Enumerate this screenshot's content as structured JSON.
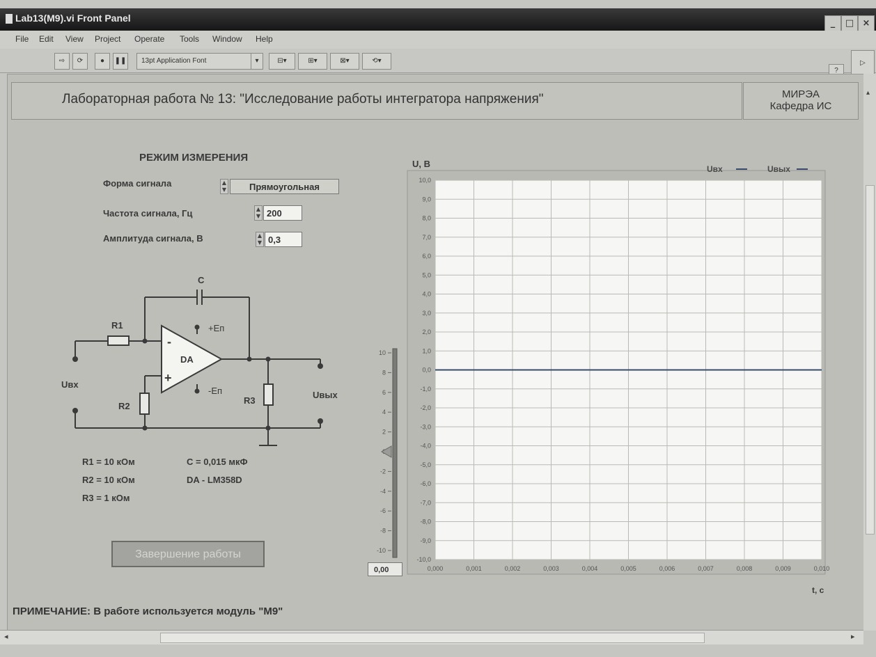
{
  "window": {
    "title": "Lab13(M9).vi Front Panel"
  },
  "menu": [
    "File",
    "Edit",
    "View",
    "Project",
    "Operate",
    "Tools",
    "Window",
    "Help"
  ],
  "toolbar": {
    "font_selector": "13pt Application Font",
    "help_icon": "?"
  },
  "header": {
    "title": "Лабораторная работа № 13: \"Исследование работы интегратора напряжения\"",
    "org_line1": "МИРЭА",
    "org_line2": "Кафедра ИС"
  },
  "controls": {
    "section_title": "РЕЖИМ ИЗМЕРЕНИЯ",
    "waveform_label": "Форма сигнала",
    "waveform_value": "Прямоугольная",
    "frequency_label": "Частота сигнала, Гц",
    "frequency_value": "200",
    "amplitude_label": "Амплитуда сигнала, В",
    "amplitude_value": "0,3"
  },
  "circuit": {
    "c_label": "C",
    "r1_label": "R1",
    "r2_label": "R2",
    "r3_label": "R3",
    "da_label": "DA",
    "minus": "-",
    "plus": "+",
    "vplus": "+Eп",
    "vminus": "-Eп",
    "uin": "Uвх",
    "uout": "Uвых"
  },
  "params": {
    "r1": "R1 = 10 кОм",
    "r2": "R2 = 10 кОм",
    "r3": "R3 = 1 кОм",
    "c": "C  =  0,015 мкФ",
    "da": "DA - LM358D"
  },
  "exit_button": "Завершение работы",
  "note": "ПРИМЕЧАНИЕ: В работе используется модуль \"М9\"",
  "slider": {
    "ticks": [
      "10",
      "8",
      "6",
      "4",
      "2",
      "0",
      "-2",
      "-4",
      "-6",
      "-8",
      "-10"
    ],
    "min": -10,
    "max": 10,
    "value": 0,
    "readout": "0,00"
  },
  "chart_data": {
    "type": "line",
    "ylabel": "U, В",
    "xlabel": "t, с",
    "xlim": [
      0,
      0.01
    ],
    "ylim": [
      -10,
      10
    ],
    "grid": true,
    "legend_position": "top-right",
    "x_ticks": [
      "0,000",
      "0,001",
      "0,002",
      "0,003",
      "0,004",
      "0,005",
      "0,006",
      "0,007",
      "0,008",
      "0,009",
      "0,010"
    ],
    "y_ticks": [
      "10,0",
      "9,0",
      "8,0",
      "7,0",
      "6,0",
      "5,0",
      "4,0",
      "3,0",
      "2,0",
      "1,0",
      "0,0",
      "-1,0",
      "-2,0",
      "-3,0",
      "-4,0",
      "-5,0",
      "-6,0",
      "-7,0",
      "-8,0",
      "-9,0",
      "-10,0"
    ],
    "series": [
      {
        "name": "Uвх",
        "color": "#3a4a6a",
        "x": [
          0,
          0.01
        ],
        "y": [
          0,
          0
        ]
      },
      {
        "name": "Uвых",
        "color": "#3a4a6a",
        "x": [
          0,
          0.01
        ],
        "y": [
          0,
          0
        ]
      }
    ]
  }
}
